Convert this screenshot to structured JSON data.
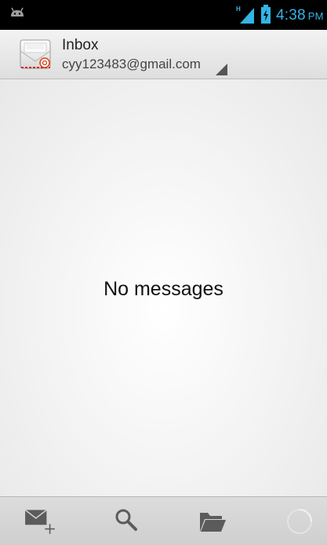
{
  "status_bar": {
    "network_type": "H",
    "time": "4:38",
    "ampm": "PM",
    "accent_color": "#33b5e5"
  },
  "action_bar": {
    "title": "Inbox",
    "account": "cyy123483@gmail.com"
  },
  "content": {
    "empty_message": "No messages"
  },
  "bottom_bar": {
    "buttons": [
      {
        "icon": "compose-mail-icon"
      },
      {
        "icon": "search-icon"
      },
      {
        "icon": "folder-icon"
      },
      {
        "icon": "refresh-spinner-icon"
      }
    ]
  }
}
